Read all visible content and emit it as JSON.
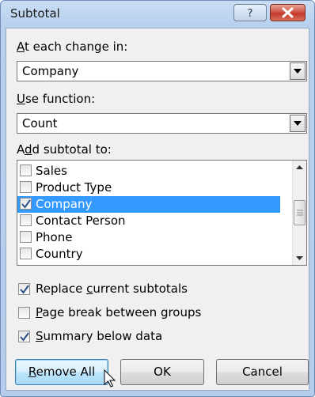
{
  "window": {
    "title": "Subtotal",
    "help_label": "?",
    "help_icon": "question-mark-icon",
    "close_icon": "close-x-icon"
  },
  "at_each_change": {
    "label_hotkey": "A",
    "label_rest": "t each change in:",
    "value": "Company"
  },
  "use_function": {
    "label_hotkey": "U",
    "label_rest": "se function:",
    "value": "Count"
  },
  "add_subtotal": {
    "label_pre": "A",
    "label_hotkey": "d",
    "label_rest": "d subtotal to:",
    "items": [
      {
        "label": "Sales",
        "checked": false,
        "selected": false
      },
      {
        "label": "Product Type",
        "checked": false,
        "selected": false
      },
      {
        "label": "Company",
        "checked": true,
        "selected": true
      },
      {
        "label": "Contact Person",
        "checked": false,
        "selected": false
      },
      {
        "label": "Phone",
        "checked": false,
        "selected": false
      },
      {
        "label": "Country",
        "checked": false,
        "selected": false
      }
    ]
  },
  "options": {
    "replace": {
      "pre": "Replace ",
      "hotkey": "c",
      "rest": "urrent subtotals",
      "checked": true
    },
    "page_break": {
      "pre": "",
      "hotkey": "P",
      "rest": "age break between groups",
      "checked": false
    },
    "summary": {
      "pre": "",
      "hotkey": "S",
      "rest": "ummary below data",
      "checked": true
    }
  },
  "buttons": {
    "remove_hotkey": "R",
    "remove_rest": "emove All",
    "ok": "OK",
    "cancel": "Cancel"
  },
  "colors": {
    "selection": "#3399ff",
    "title_bar": "#b9d1ef",
    "close_button": "#c3382a"
  }
}
